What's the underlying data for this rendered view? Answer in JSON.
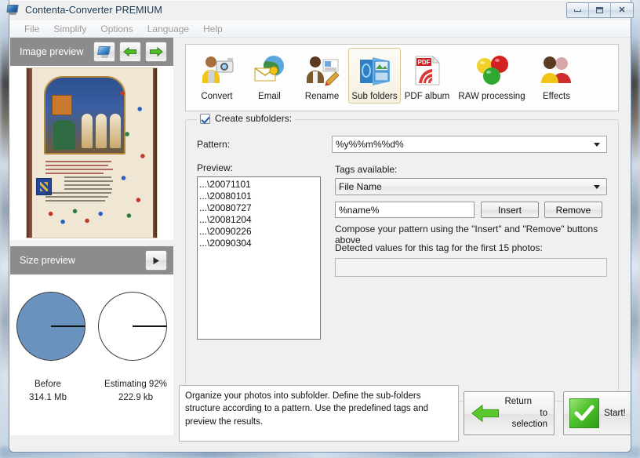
{
  "window": {
    "title": "Contenta-Converter PREMIUM",
    "icon": "monitor-icon",
    "buttons": {
      "minimize": "minimize-icon",
      "maximize": "maximize-icon",
      "close": "close-icon"
    }
  },
  "menubar": {
    "items": [
      {
        "label": "File"
      },
      {
        "label": "Simplify"
      },
      {
        "label": "Options"
      },
      {
        "label": "Language"
      },
      {
        "label": "Help"
      }
    ]
  },
  "sidebar": {
    "image_preview": {
      "title": "Image preview",
      "buttons": [
        {
          "name": "fullscreen-preview-button",
          "icon": "monitor-icon"
        },
        {
          "name": "previous-image-button",
          "icon": "arrow-left-icon"
        },
        {
          "name": "next-image-button",
          "icon": "arrow-right-icon"
        }
      ]
    },
    "size_preview": {
      "title": "Size preview",
      "play_button": "play-icon",
      "before": {
        "label": "Before",
        "value": "314.1 Mb"
      },
      "after": {
        "label": "Estimating 92%",
        "value": "222.9 kb"
      }
    }
  },
  "toolbar": {
    "items": [
      {
        "label": "Convert",
        "icon": "person-camera-icon",
        "selected": false
      },
      {
        "label": "Email",
        "icon": "email-globe-icon",
        "selected": false
      },
      {
        "label": "Rename",
        "icon": "person-pencil-icon",
        "selected": false
      },
      {
        "label": "Sub folders",
        "icon": "folder-image-icon",
        "selected": true
      },
      {
        "label": "PDF album",
        "icon": "pdf-document-icon",
        "selected": false
      },
      {
        "label": "RAW processing",
        "icon": "color-balls-icon",
        "selected": false
      },
      {
        "label": "Effects",
        "icon": "two-people-icon",
        "selected": false
      }
    ]
  },
  "form": {
    "create_subfolders_label": "Create subfolders:",
    "create_subfolders_checked": true,
    "pattern_label": "Pattern:",
    "pattern_value": "%y%%m%%d%",
    "preview_label": "Preview:",
    "preview_items": [
      "...\\20071101",
      "...\\20080101",
      "...\\20080727",
      "...\\20081204",
      "...\\20090226",
      "...\\20090304"
    ],
    "tags_available_label": "Tags available:",
    "tags_selected": "File Name",
    "tag_input_value": "%name%",
    "insert_button": "Insert",
    "remove_button": "Remove",
    "compose_hint": "Compose your pattern using the \"Insert\" and \"Remove\" buttons above",
    "detected_label": "Detected values for this tag for the first 15 photos:",
    "detected_value": ""
  },
  "footer": {
    "description": "Organize your photos into subfolder. Define the sub-folders structure according to a pattern. Use the predefined tags and preview the results.",
    "return_button_line1": "Return",
    "return_button_line2": "to selection",
    "start_button": "Start!"
  },
  "colors": {
    "panel_header": "#8c8c8c",
    "pie_fill": "#6b93c0",
    "accent_green": "#3fae22",
    "window_bg": "#f0f0f0"
  },
  "chart_data": {
    "type": "pie",
    "title": "Size preview",
    "charts": [
      {
        "label": "Before",
        "value_text": "314.1 Mb",
        "value_mb": 314.1,
        "filled_fraction": 1.0,
        "fill_color": "#6b93c0"
      },
      {
        "label": "Estimating 92%",
        "value_text": "222.9 kb",
        "value_mb": 0.2229,
        "percent": 92,
        "filled_fraction": 0.0,
        "fill_color": "#ffffff"
      }
    ],
    "legend": "none",
    "grid": false
  }
}
